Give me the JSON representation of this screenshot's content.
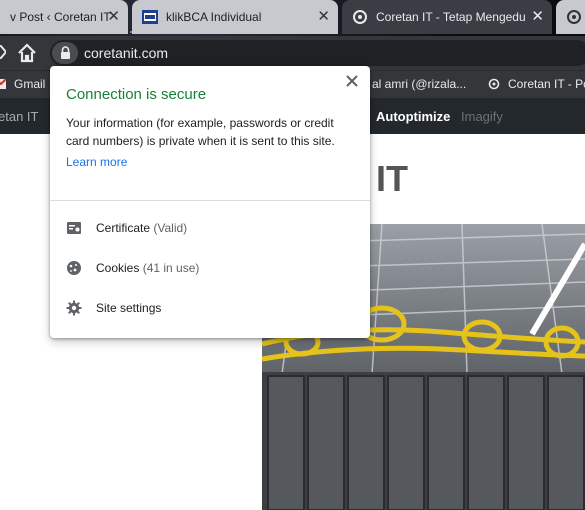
{
  "tabs": [
    {
      "title": "v Post ‹ Coretan IT",
      "state": "inactive"
    },
    {
      "title": "klikBCA Individual",
      "state": "inactive"
    },
    {
      "title": "Coretan IT - Tetap Mengedu",
      "state": "active"
    }
  ],
  "toolbar": {
    "url": "coretanit.com"
  },
  "bookmarks": [
    {
      "label": "Gmail",
      "icon": "gmail-icon"
    },
    {
      "label": "al amri (@rizala...",
      "icon": "twitter-icon"
    },
    {
      "label": "Coretan IT - Po",
      "icon": "site-icon"
    }
  ],
  "admin_bar": {
    "items": [
      {
        "label": "etan IT"
      },
      {
        "label": "Autoptimize"
      },
      {
        "label": "Imagify"
      }
    ]
  },
  "page": {
    "title_fragment": "IT"
  },
  "security_popup": {
    "title": "Connection is secure",
    "description": "Your information (for example, passwords or credit card numbers) is private when it is sent to this site.",
    "learn_more": "Learn more",
    "certificate_label": "Certificate",
    "certificate_status": "(Valid)",
    "cookies_label": "Cookies",
    "cookies_status": "(41 in use)",
    "site_settings_label": "Site settings"
  },
  "colors": {
    "secure_green": "#188038",
    "link_blue": "#1a73e8",
    "toolbar_dark": "#35363a",
    "admin_bar": "#23282d"
  }
}
